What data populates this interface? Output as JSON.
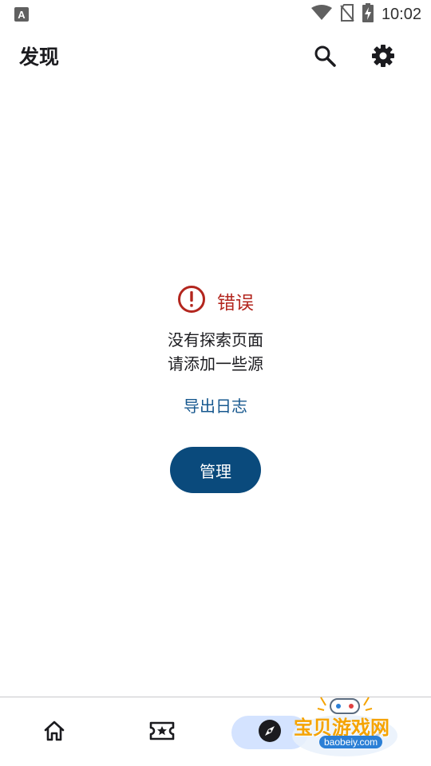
{
  "status_bar": {
    "time": "10:02",
    "left_icon": "a-notification-icon",
    "right_icons": [
      "wifi-icon",
      "no-sim-icon",
      "battery-charging-icon"
    ]
  },
  "app_bar": {
    "title": "发现",
    "actions": [
      "search-icon",
      "settings-gear-icon"
    ]
  },
  "error": {
    "icon": "error-circle-icon",
    "title": "错误",
    "message_line1": "没有探索页面",
    "message_line2": "请添加一些源",
    "export_log_label": "导出日志",
    "manage_label": "管理"
  },
  "bottom_nav": {
    "items": [
      {
        "icon": "home-icon",
        "selected": false
      },
      {
        "icon": "star-ticket-icon",
        "selected": false
      },
      {
        "icon": "compass-icon",
        "selected": true
      },
      {
        "icon": "more-icon",
        "selected": false
      }
    ]
  },
  "watermark": {
    "text": "宝贝游戏网",
    "url": "baobeiy.com"
  },
  "colors": {
    "error": "#b3261e",
    "link": "#17588f",
    "primary_button": "#0a4a7c",
    "nav_selected_pill": "#d4e3ff"
  }
}
